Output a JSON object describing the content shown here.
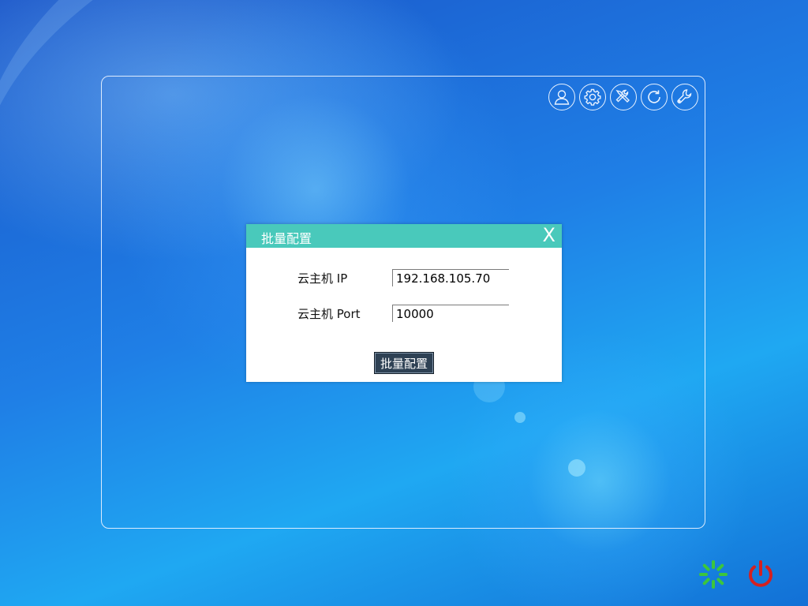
{
  "dialog": {
    "title": "批量配置",
    "close_label": "X",
    "fields": [
      {
        "label": "云主机 IP",
        "value": "192.168.105.70"
      },
      {
        "label": "云主机 Port",
        "value": "10000"
      }
    ],
    "submit_label": "批量配置"
  },
  "toolbar": {
    "icons": [
      "user-icon",
      "gear-icon",
      "tools-icon",
      "refresh-icon",
      "wrench-icon"
    ]
  },
  "corner": {
    "icons": [
      "loading-spinner-icon",
      "power-icon"
    ]
  },
  "colors": {
    "title_bar": "#49c9bb",
    "button": "#2e4154",
    "spinner": "#3cc63c",
    "power": "#d42020"
  }
}
